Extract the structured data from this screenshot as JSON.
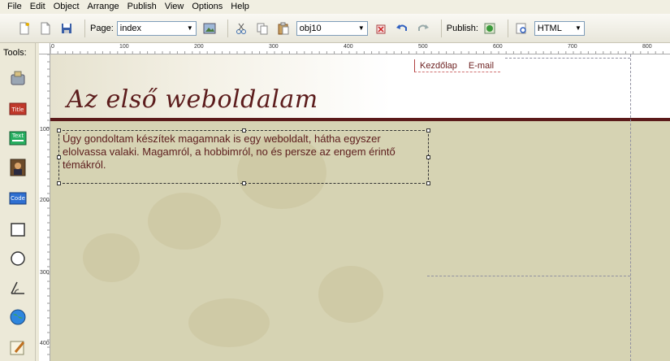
{
  "menu": [
    "File",
    "Edit",
    "Object",
    "Arrange",
    "Publish",
    "View",
    "Options",
    "Help"
  ],
  "toolbar": {
    "page_label": "Page:",
    "page_value": "index",
    "object_value": "obj10",
    "publish_label": "Publish:",
    "format_value": "HTML"
  },
  "tools": {
    "label": "Tools:",
    "items": [
      {
        "name": "pointer-tool-icon"
      },
      {
        "name": "title-tool-icon",
        "text": "Title"
      },
      {
        "name": "text-tool-icon",
        "text": "Text"
      },
      {
        "name": "image-tool-icon"
      },
      {
        "name": "code-tool-icon",
        "text": "Code"
      },
      {
        "name": "rectangle-tool-icon"
      },
      {
        "name": "ellipse-tool-icon"
      },
      {
        "name": "polygon-tool-icon"
      },
      {
        "name": "globe-tool-icon"
      },
      {
        "name": "form-tool-icon"
      }
    ]
  },
  "ruler": {
    "h_marks": [
      "0",
      "100",
      "200",
      "300",
      "400",
      "500",
      "600",
      "700",
      "800"
    ],
    "v_marks": [
      "100",
      "200",
      "300",
      "400"
    ]
  },
  "page": {
    "title": "Az első weboldalam",
    "nav": [
      "Kezdőlap",
      "E-mail"
    ],
    "body_text": "Úgy gondoltam készítek magamnak is egy weboldalt, hátha egyszer elolvassa valaki. Magamról, a hobbimról, no és persze az engem érintő témákról."
  },
  "colors": {
    "title": "#5c1c1c",
    "accent_line": "#5b1a1a",
    "canvas_bg": "#d6d3b3"
  }
}
